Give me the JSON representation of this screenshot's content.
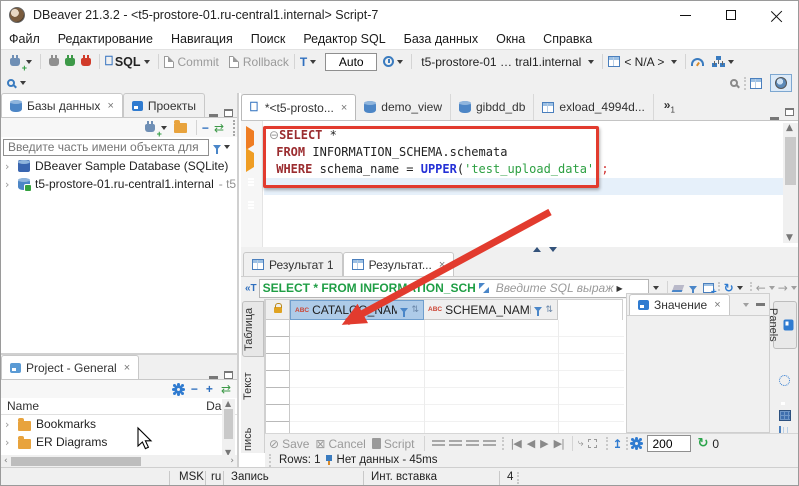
{
  "window": {
    "title": "DBeaver 21.3.2 - <t5-prostore-01.ru-central1.internal> Script-7"
  },
  "menu": {
    "items": [
      "Файл",
      "Редактирование",
      "Навигация",
      "Поиск",
      "Редактор SQL",
      "База данных",
      "Окна",
      "Справка"
    ]
  },
  "toolbar": {
    "sql_label": "SQL",
    "commit_label": "Commit",
    "rollback_label": "Rollback",
    "auto_value": "Auto",
    "connection_label": "t5-prostore-01 … tral1.internal",
    "schema_label": "< N/A >"
  },
  "navigator": {
    "tab_databases": "Базы данных",
    "tab_projects": "Проекты",
    "filter_placeholder": "Введите часть имени объекта для",
    "items": [
      {
        "label": "DBeaver Sample Database (SQLite)",
        "suffix": ""
      },
      {
        "label": "t5-prostore-01.ru-central1.internal",
        "suffix": "- t5"
      }
    ]
  },
  "project": {
    "tab": "Project - General",
    "col_name": "Name",
    "col_date": "Da",
    "items": [
      "Bookmarks",
      "ER Diagrams"
    ]
  },
  "editor": {
    "tabs": [
      {
        "label": "*<t5-prosto..."
      },
      {
        "label": "demo_view"
      },
      {
        "label": "gibdd_db"
      },
      {
        "label": "exload_4994d..."
      }
    ],
    "overflow_glyph": "»",
    "overflow_count": "1",
    "sql": {
      "kw1": "SELECT",
      "t1": " *",
      "kw2": "FROM",
      "t2": " INFORMATION_SCHEMA.schemata",
      "kw3": "WHERE",
      "t3": " schema_name = ",
      "fn": "UPPER",
      "p1": "(",
      "str": "'test_upload_data'",
      "p2": ")",
      "semi": ";"
    }
  },
  "results": {
    "tab1": "Результат 1",
    "tab2": "Результат...",
    "filter_sql": "SELECT * FROM INFORMATION_SCH",
    "filter_placeholder": "Введите SQL выраж",
    "side_tab_grid": "Таблица",
    "side_tab_text": "Текст",
    "side_tab_record_partial": "пись",
    "col1": "CATALOG_NAME",
    "col2": "SCHEMA_NAME",
    "col_type_badge": "ABC",
    "value_tab": "Значение",
    "panels_tab": "Panels",
    "btn_save": "Save",
    "btn_cancel": "Cancel",
    "btn_script": "Script",
    "fetch_size": "200",
    "refresh_count": "0",
    "rows_label": "Rows: 1",
    "status_message": "Нет данных - 45ms"
  },
  "statusbar": {
    "tz": "MSK",
    "lang": "ru",
    "mode": "Запись",
    "insert_mode": "Инт. вставка",
    "position": "4"
  },
  "icons": {
    "save": "⊘",
    "cancel": "⊠",
    "refresh": "↻",
    "arrow_left": "←",
    "arrow_right": "→",
    "jump": "↥",
    "sort": "⇅",
    "fold": "⊖",
    "chevron": "›",
    "play_small": "▶",
    "nav_first": "|◀",
    "nav_prev": "◀",
    "nav_next": "▶",
    "nav_last": "▶|",
    "scroll_up": "▲",
    "scroll_down": "▼",
    "scroll_right": "›"
  }
}
